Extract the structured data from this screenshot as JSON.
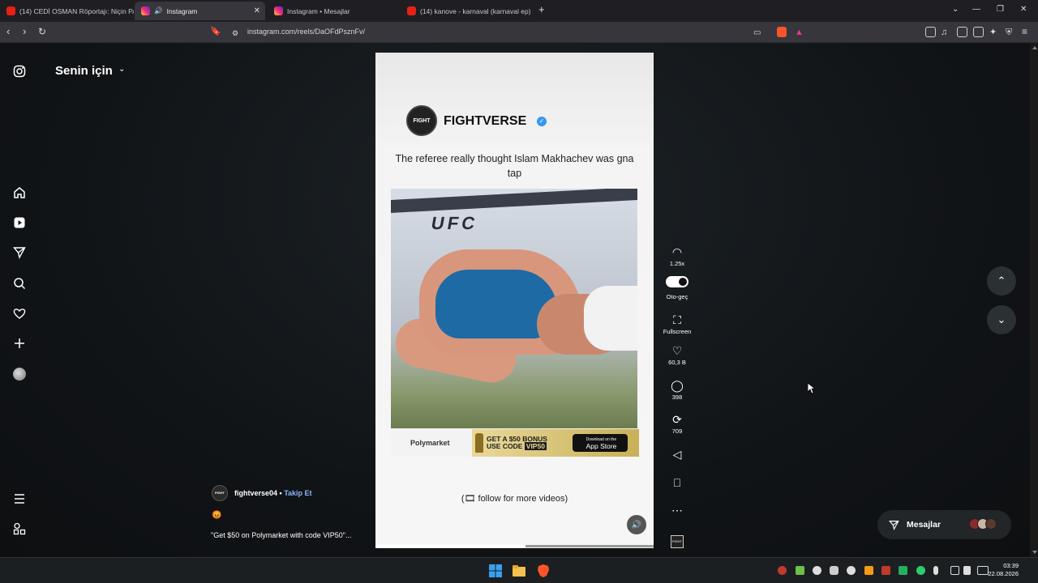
{
  "browser": {
    "tabs": [
      {
        "label": "(14) CEDİ OSMAN Röportajı: Niçin PA",
        "icon": "youtube-icon",
        "active": false
      },
      {
        "label": "Instagram",
        "icon": "instagram-icon",
        "active": true
      },
      {
        "label": "Instagram • Mesajlar",
        "icon": "instagram-icon",
        "active": false
      },
      {
        "label": "(14) kanove - karnaval (karnaval ep)",
        "icon": "youtube-icon",
        "active": false
      }
    ],
    "new_tab": "+",
    "url": "instagram.com/reels/DaOFdPsznFv/"
  },
  "sidebar": {
    "feed_title": "Senin için",
    "items": [
      "home-icon",
      "reels-icon",
      "messages-icon",
      "search-icon",
      "notifications-icon",
      "create-icon",
      "profile-avatar"
    ],
    "bottom": [
      "more-menu-icon",
      "threads-icon"
    ]
  },
  "reel": {
    "account_name": "FIGHTVERSE",
    "logo_text": "FIGHT",
    "caption": "The referee really thought  Islam Makhachev was gna tap",
    "ufc_text": "UFC",
    "ad": {
      "brand": "Polymarket",
      "bonus_line1": "GET A $50 BONUS",
      "bonus_line2": "USE CODE",
      "code": "VIP50",
      "app_store_small": "Download on the",
      "app_store": "App Store"
    },
    "follow_text": "(🎞 follow for more videos)",
    "progress": 0.54
  },
  "actions": {
    "speed": "1.25x",
    "autoplay": "Oto-geç",
    "fullscreen": "Fullscreen",
    "likes": "60,3 B",
    "comments": "398",
    "reposts": "709"
  },
  "author": {
    "username": "fightverse04",
    "separator": "•",
    "follow": "Takip Et",
    "emoji": "😡",
    "description": "\"Get $50 on Polymarket with code VIP50\"..."
  },
  "messages_button": "Mesajlar",
  "taskbar": {
    "time": "03:39",
    "date": "22.08.2026"
  },
  "colors": {
    "accent_link": "#8ab4f8",
    "verified": "#3897f0",
    "shorts_blue": "#1d6aa5"
  }
}
